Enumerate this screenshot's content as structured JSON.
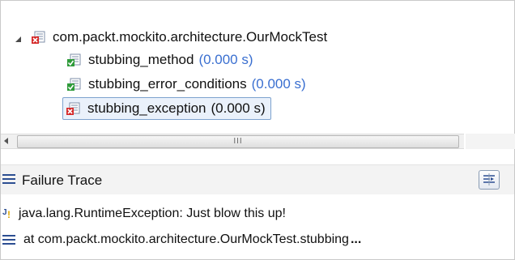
{
  "tree": {
    "suite": {
      "label": "com.packt.mockito.architecture.OurMockTest",
      "status": "error",
      "icon": "junit-suite-error-icon"
    },
    "tests": [
      {
        "label": "stubbing_method",
        "time": "(0.000 s)",
        "status": "passed",
        "icon": "junit-test-passed-icon"
      },
      {
        "label": "stubbing_error_conditions",
        "time": "(0.000 s)",
        "status": "passed",
        "icon": "junit-test-passed-icon"
      },
      {
        "label": "stubbing_exception",
        "time": "(0.000 s)",
        "status": "error",
        "icon": "junit-test-error-icon",
        "selected": true
      }
    ]
  },
  "scrollbar": {
    "grip": "III"
  },
  "failure_trace": {
    "title": "Failure Trace",
    "compare_button_icon": "compare-results-icon",
    "lines": [
      {
        "icon": "junit-exception-icon",
        "text": "java.lang.RuntimeException: Just blow this up!"
      },
      {
        "icon": "stack-frame-icon",
        "text": "at com.packt.mockito.architecture.OurMockTest.stubbing",
        "truncated": "..."
      }
    ]
  },
  "colors": {
    "time_passed": "#3a6fd0",
    "selection_border": "#7da2ce",
    "selection_fill": "#eaf1fb",
    "error_red": "#d62a2a",
    "pass_green": "#2f9b3a"
  }
}
